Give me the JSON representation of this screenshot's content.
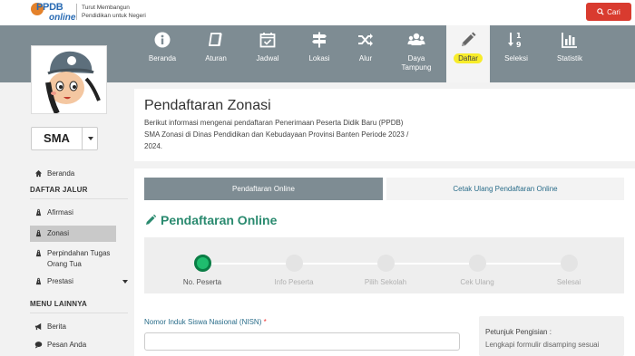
{
  "header": {
    "logo_text": "PPDB",
    "logo_sub": "online",
    "tagline_line1": "Turut Membangun",
    "tagline_line2": "Pendidikan untuk Negeri",
    "search_label": "Cari"
  },
  "nav": {
    "items": [
      {
        "label": "Beranda",
        "icon": "info-icon"
      },
      {
        "label": "Aturan",
        "icon": "book-icon"
      },
      {
        "label": "Jadwal",
        "icon": "calendar-check-icon"
      },
      {
        "label": "Lokasi",
        "icon": "signpost-icon"
      },
      {
        "label": "Alur",
        "icon": "shuffle-icon"
      },
      {
        "label": "Daya",
        "label2": "Tampung",
        "icon": "users-icon"
      },
      {
        "label": "Daftar",
        "icon": "pencil-icon",
        "active": true
      },
      {
        "label": "Seleksi",
        "icon": "sort-numeric-icon"
      },
      {
        "label": "Statistik",
        "icon": "bar-chart-icon"
      }
    ],
    "active_highlight": "#f7ec2a"
  },
  "sidebar": {
    "level_value": "SMA",
    "home_label": "Beranda",
    "section1": "DAFTAR JALUR",
    "jalur": [
      {
        "label": "Afirmasi"
      },
      {
        "label": "Zonasi",
        "active": true
      },
      {
        "label": "Perpindahan Tugas",
        "label2": "Orang Tua"
      },
      {
        "label": "Prestasi"
      }
    ],
    "section2": "MENU LAINNYA",
    "other": [
      {
        "label": "Berita"
      },
      {
        "label": "Pesan Anda"
      }
    ]
  },
  "info": {
    "title": "Pendaftaran Zonasi",
    "line1": "Berikut informasi mengenai pendaftaran Penerimaan Peserta Didik Baru (PPDB)",
    "line2": "SMA Zonasi di Dinas Pendidikan dan Kebudayaan Provinsi Banten Periode 2023 /",
    "line3": "2024."
  },
  "main": {
    "tab_active": "Pendaftaran Online",
    "tab_other": "Cetak Ulang Pendaftaran Online",
    "section_title": "Pendaftaran Online",
    "steps": [
      {
        "label": "No. Peserta",
        "done": true
      },
      {
        "label": "Info Peserta",
        "done": false
      },
      {
        "label": "Pilih Sekolah",
        "done": false
      },
      {
        "label": "Cek Ulang",
        "done": false
      },
      {
        "label": "Selesai",
        "done": false
      }
    ],
    "nisn_label": "Nomor Induk Siswa Nasional (NISN)",
    "nisn_required": "*",
    "nisn_value": "",
    "help_title": "Petunjuk Pengisian :",
    "help_text": "Lengkapi formulir disamping sesuai"
  },
  "colors": {
    "navbar": "#7e8c93",
    "accent_green": "#2a8a6f",
    "search_red": "#d93b2f",
    "step_done": "#1fbd6e"
  }
}
